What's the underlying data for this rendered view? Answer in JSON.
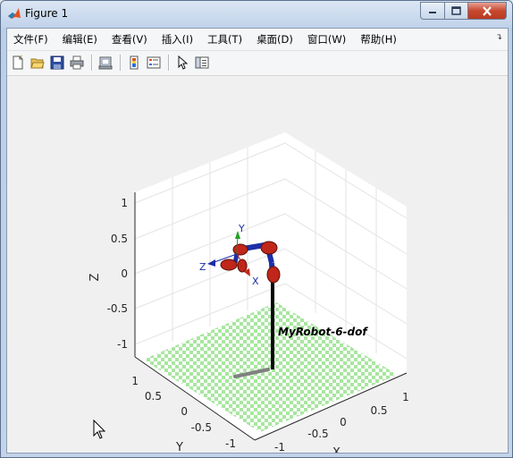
{
  "window": {
    "title": "Figure 1"
  },
  "menu": {
    "items": [
      "文件(F)",
      "编辑(E)",
      "查看(V)",
      "插入(I)",
      "工具(T)",
      "桌面(D)",
      "窗口(W)",
      "帮助(H)"
    ]
  },
  "toolbar": {
    "icons": [
      "new-figure-icon",
      "open-file-icon",
      "save-icon",
      "print-icon",
      "link-plot-icon",
      "insert-colorbar-icon",
      "insert-legend-icon",
      "edit-plot-icon",
      "property-inspector-icon"
    ]
  },
  "plot": {
    "z_axis_label": "Z",
    "y_axis_label": "Y",
    "x_axis_label": "X",
    "z_ticks": [
      "1",
      "0.5",
      "0",
      "-0.5",
      "-1"
    ],
    "y_ticks": [
      "1",
      "0.5",
      "0",
      "-0.5",
      "-1"
    ],
    "x_ticks": [
      "-1",
      "-0.5",
      "0",
      "0.5",
      "1"
    ],
    "robot_name": "MyRobot-6-dof",
    "frame_labels": {
      "x": "X",
      "y": "Y",
      "z": "Z"
    },
    "floor_colors": [
      "#a8e6a0",
      "#ffffff"
    ],
    "link_color": "#1c2fa8",
    "joint_color": "#c0261a"
  }
}
